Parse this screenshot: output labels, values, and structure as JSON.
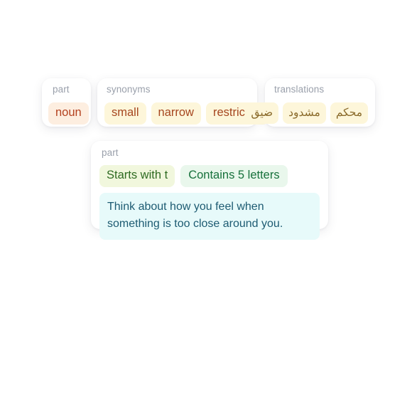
{
  "cards": {
    "part_of_speech": {
      "label": "part",
      "chips": [
        "noun"
      ]
    },
    "synonyms": {
      "label": "synonyms",
      "chips": [
        "small",
        "narrow",
        "restricted"
      ]
    },
    "translations": {
      "label": "translations",
      "chips": [
        "محكم",
        "مشدود",
        "ضيق"
      ]
    },
    "clues": {
      "label": "part",
      "chips": [
        "Starts with t",
        "Contains 5 letters"
      ],
      "hint": "Think about how you feel when something is too close around you."
    }
  },
  "colors": {
    "page_background": "#ffffff",
    "card_background": "#ffffff",
    "label_text": "#9aa0ab",
    "pos_chip_background": "#fdeee0",
    "pos_chip_text": "#b4411f",
    "synonym_chip_background": "#fdf6da",
    "synonym_chip_text": "#a6461f",
    "translation_chip_background": "#fdf6da",
    "translation_chip_text": "#8a6a2a",
    "clue_chip_a_background": "#f1f7dd",
    "clue_chip_a_text": "#2f6b22",
    "clue_chip_b_background": "#e9f7ec",
    "clue_chip_b_text": "#17713c",
    "hint_background": "#e7fafa",
    "hint_text": "#1d5b72"
  }
}
